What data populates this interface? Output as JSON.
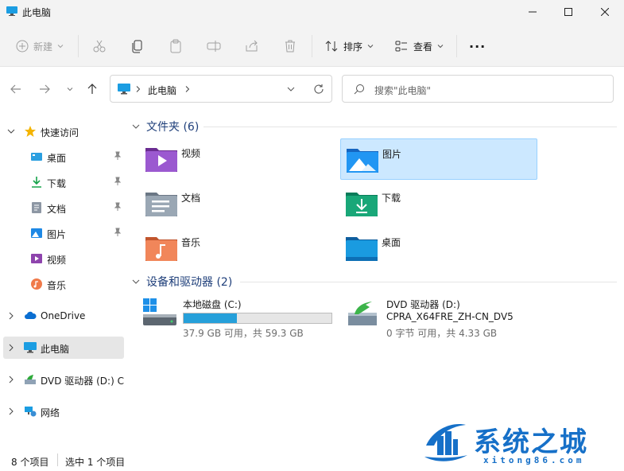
{
  "window": {
    "title": "此电脑"
  },
  "toolbar": {
    "new_label": "新建",
    "sort_label": "排序",
    "view_label": "查看",
    "more_label": "···"
  },
  "address": {
    "path": "此电脑"
  },
  "search": {
    "placeholder": "搜索\"此电脑\""
  },
  "sidebar": {
    "quick_access": "快速访问",
    "items": [
      {
        "label": "桌面",
        "icon": "desktop-icon"
      },
      {
        "label": "下载",
        "icon": "download-icon"
      },
      {
        "label": "文档",
        "icon": "document-icon"
      },
      {
        "label": "图片",
        "icon": "picture-icon"
      },
      {
        "label": "视频",
        "icon": "video-icon"
      },
      {
        "label": "音乐",
        "icon": "music-icon"
      }
    ],
    "onedrive": "OneDrive",
    "this_pc": "此电脑",
    "dvd": "DVD 驱动器 (D:) CF",
    "network": "网络"
  },
  "main": {
    "folders_header": "文件夹 (6)",
    "folders": [
      {
        "label": "视频",
        "icon": "video-folder-icon"
      },
      {
        "label": "图片",
        "icon": "picture-folder-icon",
        "selected": true
      },
      {
        "label": "文档",
        "icon": "document-folder-icon"
      },
      {
        "label": "下载",
        "icon": "download-folder-icon"
      },
      {
        "label": "音乐",
        "icon": "music-folder-icon"
      },
      {
        "label": "桌面",
        "icon": "desktop-folder-icon"
      }
    ],
    "devices_header": "设备和驱动器 (2)",
    "drives": [
      {
        "name": "本地磁盘 (C:)",
        "capacity": "37.9 GB 可用，共 59.3 GB",
        "used_fraction": 0.36
      },
      {
        "name": "DVD 驱动器 (D:)",
        "label": "CPRA_X64FRE_ZH-CN_DV5",
        "capacity": "0 字节 可用，共 4.33 GB"
      }
    ]
  },
  "status": {
    "count": "8 个项目",
    "selected": "选中 1 个项目"
  },
  "watermark": {
    "title": "系统之城",
    "url": "xitong86.com"
  },
  "colors": {
    "accent": "#0078d4",
    "selection": "#cce8ff",
    "drive_fill": "#26a0da"
  }
}
